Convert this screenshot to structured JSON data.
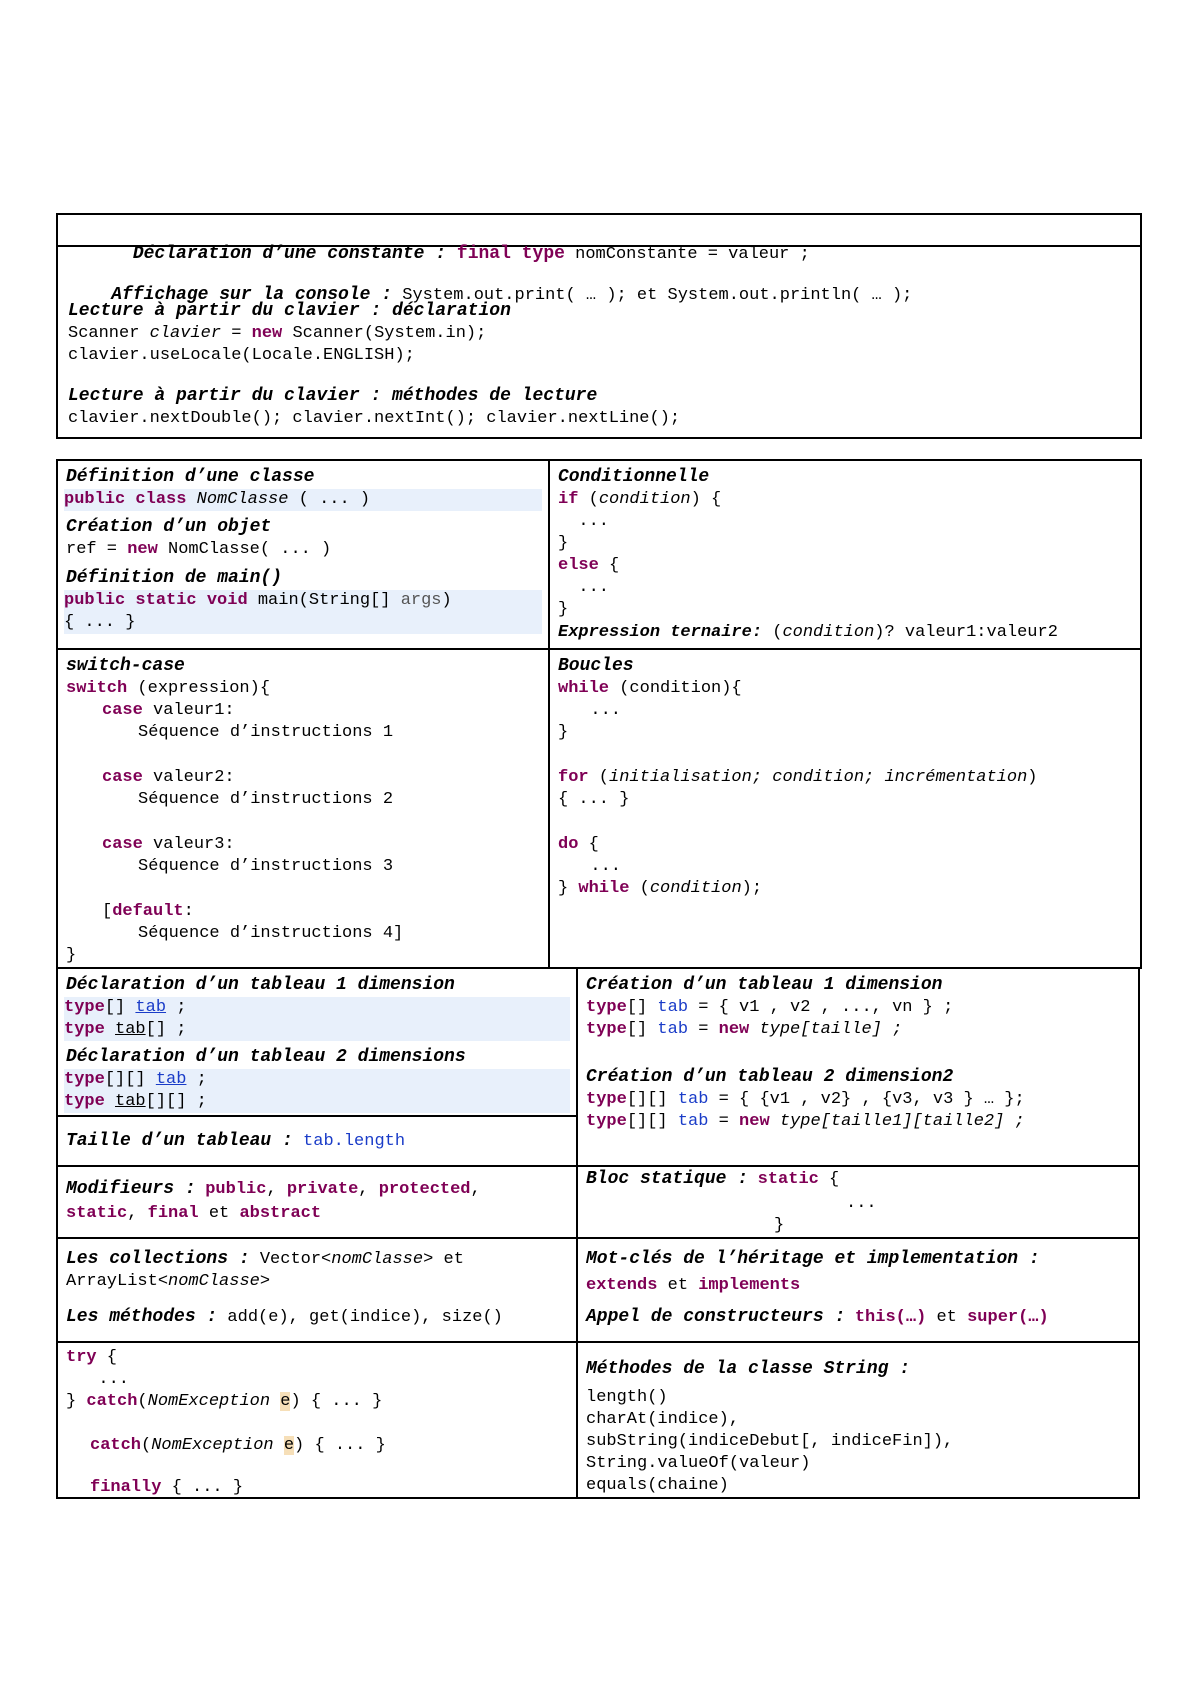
{
  "top_box": {
    "const_title": "Déclaration d’une constante :",
    "const_final": "final",
    "const_type": "type",
    "const_rest": " nomConstante = valeur ;",
    "aff_title": "Affichage sur la console :",
    "aff_code": " System.out.print( … ); et System.out.println( … );",
    "lect_decl_title": "Lecture à partir du clavier : déclaration",
    "lect_line1_a": "Scanner ",
    "lect_line1_b": "clavier",
    "lect_line1_c": " = ",
    "lect_line1_new": "new",
    "lect_line1_d": " Scanner(System.in);",
    "lect_line2": "clavier.useLocale(Locale.ENGLISH);",
    "lect_meth_title": "Lecture à partir du clavier : méthodes de lecture",
    "lect_meth_code": "clavier.nextDouble(); clavier.nextInt(); clavier.nextLine();"
  },
  "classe": {
    "def_title": "Définition d’une classe",
    "def_public": "public",
    "def_class": "class",
    "def_name": " NomClasse",
    "def_rest": " ( ... )",
    "obj_title": "Création d’un objet",
    "obj_a": "ref = ",
    "obj_new": "new",
    "obj_b": " NomClasse( ... )",
    "main_title": "Définition de main()",
    "main_public": "public",
    "main_static": "static",
    "main_void": "void",
    "main_a": " main(String[] ",
    "main_args": "args",
    "main_b": ")",
    "main_body": "{ ... }"
  },
  "cond": {
    "title": "Conditionnelle",
    "if_kw": "if",
    "if_a": " (",
    "if_cond": "condition",
    "if_b": ") {",
    "dots1": "  ...",
    "close1": "}",
    "else_kw": "else",
    "else_a": " {",
    "dots2": "  ...",
    "close2": "}",
    "tern_title": "Expression ternaire:",
    "tern_a": " (",
    "tern_cond": "condition",
    "tern_b": ")? valeur1:valeur2"
  },
  "switch": {
    "title": "switch-case",
    "sw_kw": "switch",
    "sw_a": " (expression){",
    "case_kw": "case",
    "case1": " valeur1:",
    "seq1": "Séquence d’instructions 1",
    "case2": " valeur2:",
    "seq2": "Séquence d’instructions 2",
    "case3": " valeur3:",
    "seq3": "Séquence d’instructions 3",
    "def_open": "[",
    "def_kw": "default",
    "def_close": ":",
    "seq4": "Séquence d’instructions 4]",
    "close": "}"
  },
  "boucles": {
    "title": "Boucles",
    "while_kw": "while",
    "while_a": " (condition){",
    "dots1": "  ...",
    "close1": "}",
    "for_kw": "for",
    "for_a": " (",
    "for_b": "initialisation; condition; incrémentation",
    "for_c": ")",
    "for_body": "{ ... }",
    "do_kw": "do",
    "do_a": " {",
    "dots2": "  ...",
    "do_close": "} ",
    "do_cond_a": " (",
    "do_cond": "condition",
    "do_cond_b": ");"
  },
  "decl_tab": {
    "t1_title": "Déclaration d’un tableau 1 dimension",
    "type_kw": "type",
    "l1_a": "[] ",
    "tab": "tab",
    "l1_b": " ;",
    "l2_a": " ",
    "l2_b": "[] ;",
    "t2_title": "Déclaration d’un tableau 2 dimensions",
    "l3_a": "[][] ",
    "l3_b": " ;",
    "l4_b": "[][] ;",
    "taille_title": "Taille d’un tableau :",
    "taille_code": " tab.length"
  },
  "creat_tab": {
    "t1_title": "Création d’un tableau 1 dimension",
    "l1_a": "[] ",
    "l1_b": " = { v1 , v2 , ..., vn } ;",
    "l2_b": " = ",
    "new_kw": "new",
    "l2_c": " type[taille] ;",
    "t2_title": "Création d’un tableau 2 dimension2",
    "l3_a": "[][] ",
    "l3_b": " = { {v1 , v2} , {v3, v3 } … };",
    "l4_c": " type[taille1][taille2] ;"
  },
  "modif": {
    "title": "Modifieurs :",
    "public": "public",
    "private": "private",
    "protected": "protected",
    "static": "static",
    "final": "final",
    "et": " et ",
    "abstract": "abstract",
    "comma": ", "
  },
  "bloc": {
    "title": "Bloc statique :",
    "static_kw": "static",
    "brace": " {",
    "dots": "...",
    "close": "}"
  },
  "coll": {
    "title": "Les collections :",
    "a": " Vector<",
    "nom": "nomClasse",
    "b": "> et",
    "c": "ArrayList<",
    "d": ">",
    "meth_title": "Les méthodes :",
    "meth_code": " add(e), get(indice), size()"
  },
  "herit": {
    "title": "Mot-clés de l’héritage et implementation :",
    "extends": "extends",
    "et": " et ",
    "implements": "implements",
    "appel_title": "Appel de constructeurs :",
    "this": "this(…)",
    "super": "super(…)"
  },
  "trycatch": {
    "try_kw": "try",
    "brace": " {",
    "dots": "  ...",
    "close": "} ",
    "catch_kw": "catch",
    "paren": "(",
    "exc": "NomException",
    "e": "e",
    "rest": ") { ... }",
    "finally_kw": "finally",
    "fin_rest": " { ... }"
  },
  "string": {
    "title": "Méthodes de la classe String :",
    "m1": "length()",
    "m2": "charAt(indice),",
    "m3": "subString(indiceDebut[, indiceFin]),",
    "m4": "String.valueOf(valeur)",
    "m5": "equals(chaine)"
  }
}
